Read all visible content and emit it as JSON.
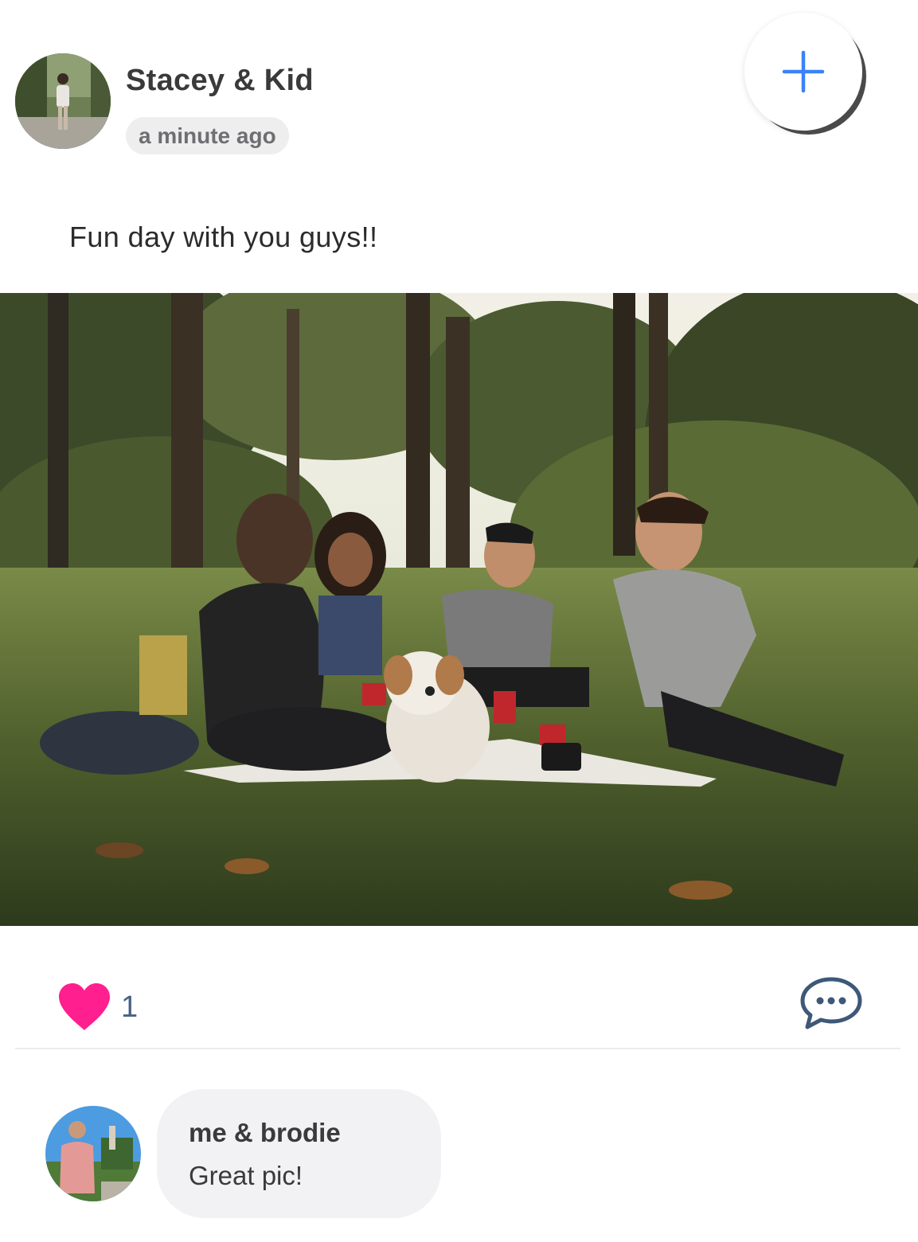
{
  "post": {
    "author": "Stacey & Kid",
    "time": "a minute ago",
    "caption": "Fun day with you guys!!",
    "likes": "1"
  },
  "icons": {
    "add": "plus-icon",
    "like": "heart-icon",
    "comment": "chat-bubble-icon"
  },
  "colors": {
    "accent": "#3b82f6",
    "like": "#ff1f8e",
    "comment_icon": "#3e5878",
    "like_count": "#4a6185",
    "bubble": "#f2f2f4"
  },
  "comments": [
    {
      "author": "me & brodie",
      "text": "Great pic!"
    }
  ]
}
